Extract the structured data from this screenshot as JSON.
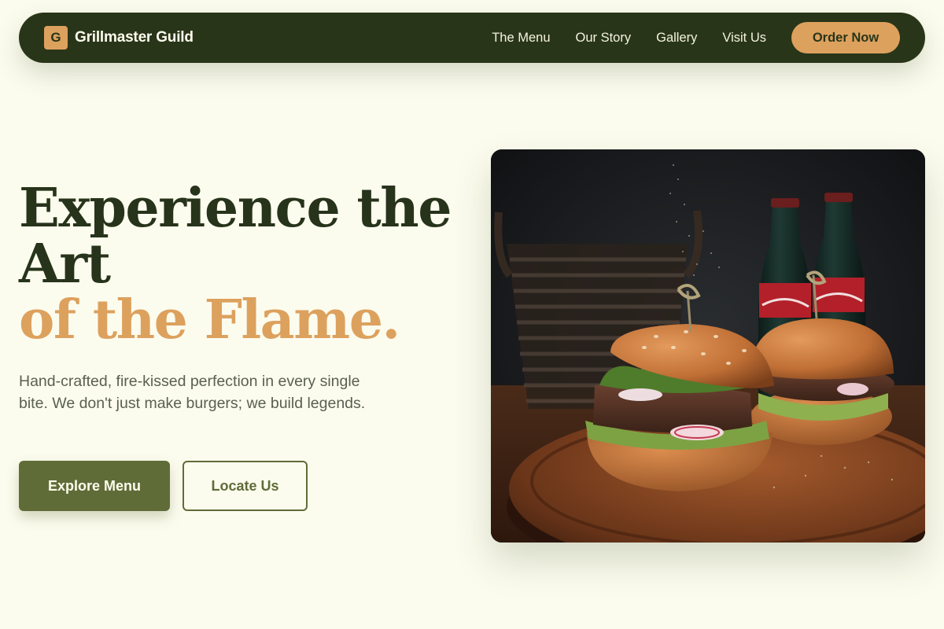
{
  "brand": {
    "initial": "G",
    "name": "Grillmaster Guild"
  },
  "nav": {
    "links": [
      "The Menu",
      "Our Story",
      "Gallery",
      "Visit Us"
    ],
    "cta": "Order Now"
  },
  "hero": {
    "title_line_1": "Experience the Art",
    "title_line_2": "of the Flame.",
    "subtitle": "Hand-crafted, fire-kissed perfection in every single bite. We don't just make burgers; we build legends.",
    "primary_button": "Explore Menu",
    "secondary_button": "Locate Us"
  },
  "colors": {
    "background": "#fcfcee",
    "nav": "#293518",
    "accent": "#dda15e",
    "primary": "#606c38",
    "text": "#27331a"
  }
}
